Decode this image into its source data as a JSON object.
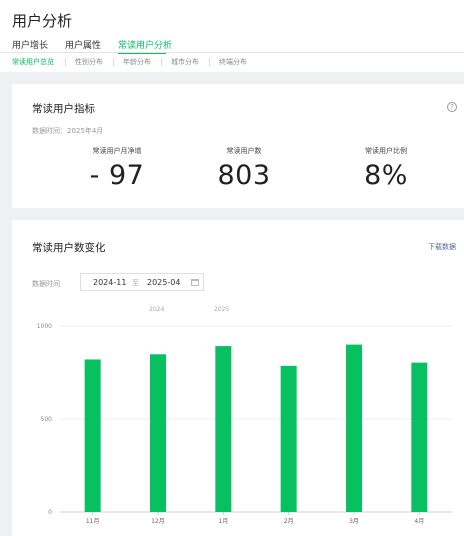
{
  "page": {
    "title": "用户分析"
  },
  "tabs": [
    {
      "label": "用户增长",
      "active": false
    },
    {
      "label": "用户属性",
      "active": false
    },
    {
      "label": "常读用户分析",
      "active": true
    }
  ],
  "subtabs": [
    {
      "label": "常读用户总览",
      "active": true
    },
    {
      "label": "性别分布",
      "active": false
    },
    {
      "label": "年龄分布",
      "active": false
    },
    {
      "label": "城市分布",
      "active": false
    },
    {
      "label": "终端分布",
      "active": false
    }
  ],
  "indicators": {
    "title": "常读用户指标",
    "help_icon": "?",
    "data_time": "数据时间：2025年4月",
    "metrics": [
      {
        "label": "常读用户月净增",
        "value": "- 97"
      },
      {
        "label": "常读用户数",
        "value": "803"
      },
      {
        "label": "常读用户比例",
        "value": "8%"
      }
    ]
  },
  "trend": {
    "title": "常读用户数变化",
    "download_label": "下载数据",
    "date_label": "数据时间",
    "date_start": "2024-11",
    "date_sep": "至",
    "date_end": "2025-04",
    "year_labels": [
      "2024",
      "2025"
    ]
  },
  "colors": {
    "accent": "#07c160",
    "link": "#576b95"
  },
  "chart_data": {
    "type": "bar",
    "categories": [
      "11月",
      "12月",
      "1月",
      "2月",
      "3月",
      "4月"
    ],
    "values": [
      820,
      848,
      892,
      786,
      900,
      803
    ],
    "ylim": [
      0,
      1000
    ],
    "yticks": [
      0,
      500,
      1000
    ],
    "grid": true,
    "color": "#07c160"
  }
}
